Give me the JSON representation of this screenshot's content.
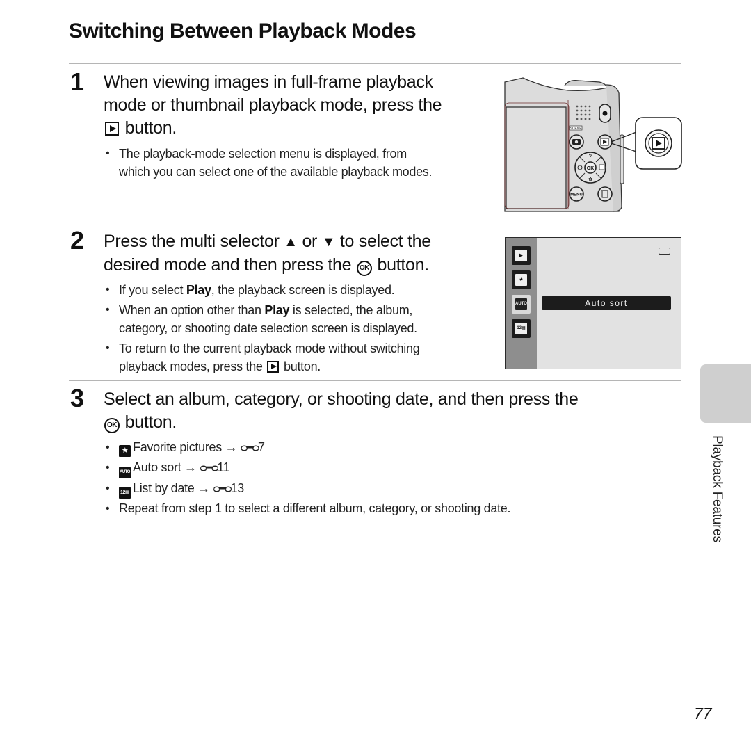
{
  "page": {
    "title": "Switching Between Playback Modes",
    "side_section": "Playback Features",
    "page_number": "77"
  },
  "steps": [
    {
      "number": "1",
      "heading_line1": "When viewing images in full-frame playback",
      "heading_line2": "mode or thumbnail playback mode, press the",
      "heading_line3_suffix": "button.",
      "bullets": [
        {
          "line1": "The playback-mode selection menu is displayed, from",
          "line2": "which you can select one of the available playback modes."
        }
      ]
    },
    {
      "number": "2",
      "heading_a": "Press the multi selector",
      "heading_or": "or",
      "heading_b": "to select the",
      "heading_line2_a": "desired mode and then press the",
      "heading_line2_b": "button.",
      "bullets": [
        {
          "pre": "If you select ",
          "bold": "Play",
          "post": ", the playback screen is displayed."
        },
        {
          "pre": "When an option other than ",
          "bold": "Play",
          "post": " is selected, the album,",
          "line2": "category, or shooting date selection screen is displayed."
        },
        {
          "line1": "To return to the current playback mode without switching",
          "line2_pre": "playback modes, press the",
          "line2_post": "button."
        }
      ]
    },
    {
      "number": "3",
      "heading_line1": "Select an album, category, or shooting date, and then press the",
      "heading_line2_suffix": "button.",
      "bullets": [
        {
          "icon": "favorite-album-icon",
          "icon_text": "★",
          "label": "Favorite pictures",
          "arrow": "→",
          "ref_glyph": "ᴑ━ᴑ",
          "ref": "7"
        },
        {
          "icon": "auto-sort-icon",
          "icon_text": "AUTO",
          "label": "Auto sort",
          "arrow": "→",
          "ref_glyph": "ᴑ━ᴑ",
          "ref": "11"
        },
        {
          "icon": "list-by-date-icon",
          "icon_text": "12▦",
          "label": "List by date",
          "arrow": "→",
          "ref_glyph": "ᴑ━ᴑ",
          "ref": "13"
        },
        {
          "text": "Repeat from step 1 to select a different album, category, or shooting date."
        }
      ]
    }
  ],
  "icons": {
    "ok_text": "OK",
    "up_triangle": "▲",
    "down_triangle": "▼"
  },
  "camera_illustration": {
    "labels": {
      "scene": "SCENE",
      "menu": "MENU",
      "ok": "OK"
    }
  },
  "lcd_screen": {
    "menu_items": [
      {
        "icon": "play-mode-icon",
        "text": "▶"
      },
      {
        "icon": "favorite-pictures-icon",
        "text": "★"
      },
      {
        "icon": "auto-sort-icon",
        "text": "AUTO",
        "selected": true
      },
      {
        "icon": "list-by-date-icon",
        "text": "12▦"
      }
    ],
    "selected_label": "Auto sort"
  },
  "colors": {
    "text": "#1a1a1a",
    "rule": "#b5b5b5",
    "side_tab": "#cfcfcf",
    "lcd_bg": "#e2e2e2",
    "lcd_sidebar": "#8e8e8e"
  }
}
